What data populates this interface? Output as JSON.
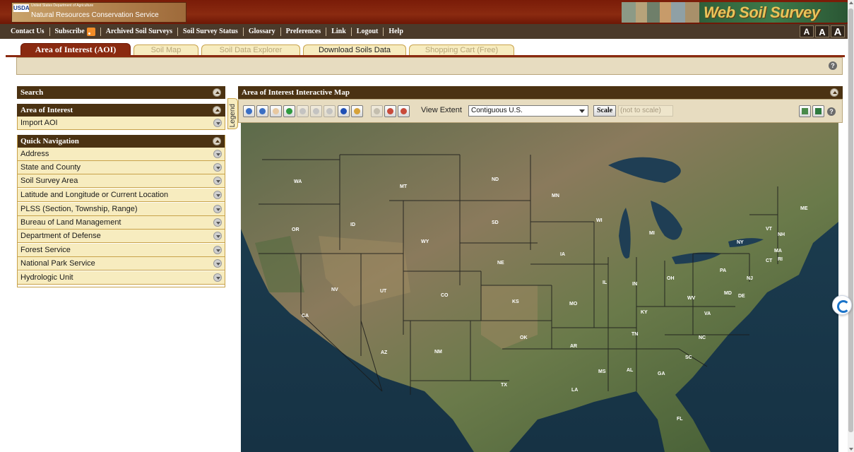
{
  "header": {
    "usda_mark": "USDA",
    "department": "United States Department of Agriculture",
    "agency": "Natural Resources Conservation Service",
    "app_logo": "Web Soil Survey"
  },
  "nav": {
    "links": [
      "Contact Us",
      "Subscribe",
      "Archived Soil Surveys",
      "Soil Survey Status",
      "Glossary",
      "Preferences",
      "Link",
      "Logout",
      "Help"
    ],
    "text_size": [
      "A",
      "A",
      "A"
    ]
  },
  "tabs": [
    {
      "label": "Area of Interest (AOI)",
      "state": "active"
    },
    {
      "label": "Soil Map",
      "state": "disabled"
    },
    {
      "label": "Soil Data Explorer",
      "state": "disabled"
    },
    {
      "label": "Download Soils Data",
      "state": "enabled"
    },
    {
      "label": "Shopping Cart (Free)",
      "state": "disabled"
    }
  ],
  "left_panel": {
    "search": "Search",
    "aoi_header": "Area of Interest",
    "import_aoi": "Import AOI",
    "quick_nav_header": "Quick Navigation",
    "quick_nav_items": [
      "Address",
      "State and County",
      "Soil Survey Area",
      "Latitude and Longitude or Current Location",
      "PLSS (Section, Township, Range)",
      "Bureau of Land Management",
      "Department of Defense",
      "Forest Service",
      "National Park Service",
      "Hydrologic Unit"
    ]
  },
  "legend_tab": "Legend",
  "map_panel": {
    "title": "Area of Interest Interactive Map",
    "view_extent_label": "View Extent",
    "view_extent_value": "Contiguous U.S.",
    "scale_button": "Scale",
    "scale_value": "(not to scale)",
    "tool_icons": [
      "zoom-in",
      "zoom-out",
      "pan",
      "full-extent",
      "previous-extent",
      "next-extent",
      "refresh",
      "identify",
      "measure",
      "define-aoi-rectangle",
      "define-aoi-polygon",
      "clear-aoi"
    ]
  },
  "map_labels": [
    "WA",
    "MT",
    "ND",
    "MN",
    "OR",
    "ID",
    "SD",
    "WI",
    "MI",
    "ME",
    "WY",
    "VT",
    "NH",
    "NY",
    "MA",
    "IA",
    "NE",
    "CT",
    "RI",
    "PA",
    "NJ",
    "NV",
    "UT",
    "CO",
    "IL",
    "IN",
    "OH",
    "CA",
    "KS",
    "MO",
    "WV",
    "MD",
    "DE",
    "VA",
    "KY",
    "TN",
    "NC",
    "OK",
    "AR",
    "AZ",
    "NM",
    "SC",
    "MS",
    "AL",
    "GA",
    "TX",
    "LA",
    "FL"
  ],
  "colors": {
    "banner": "#8a2a10",
    "navbar": "#4b3a2a",
    "panel_header": "#4b3212",
    "item_bg": "#f7ecbf",
    "toolbar_bg": "#e7dcc0"
  }
}
